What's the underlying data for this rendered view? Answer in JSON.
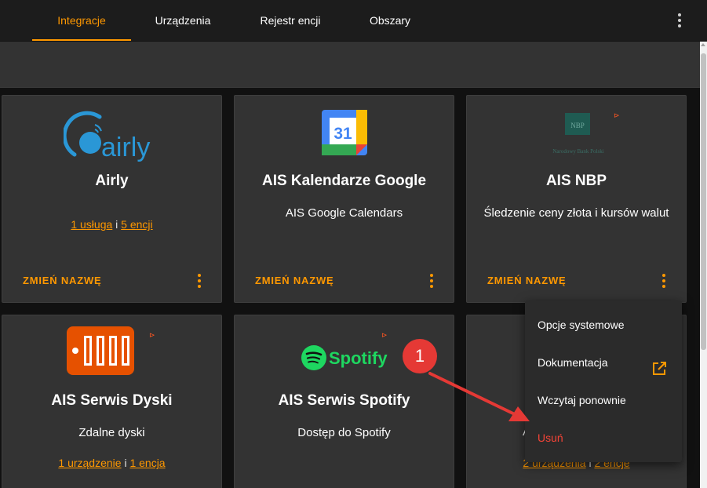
{
  "tabs": [
    {
      "label": "Integracje",
      "active": true
    },
    {
      "label": "Urządzenia",
      "active": false
    },
    {
      "label": "Rejestr encji",
      "active": false
    },
    {
      "label": "Obszary",
      "active": false
    }
  ],
  "cards": [
    {
      "title": "Airly",
      "description": "",
      "links": [
        {
          "text": "1 usługa"
        },
        {
          "sep": " i "
        },
        {
          "text": "5 encji"
        }
      ],
      "rename_label": "ZMIEŃ NAZWĘ",
      "logo": "airly-logo",
      "logo_text": "airly"
    },
    {
      "title": "AIS Kalendarze Google",
      "description": "AIS Google Calendars",
      "rename_label": "ZMIEŃ NAZWĘ",
      "logo": "google-calendar-logo",
      "logo_text": "31"
    },
    {
      "title": "AIS NBP",
      "description": "Śledzenie ceny złota i kursów walut",
      "rename_label": "ZMIEŃ NAZWĘ",
      "logo": "nbp-logo",
      "logo_text": "NBP",
      "logo_subtext": "Narodowy Bank Polski"
    },
    {
      "title": "AIS Serwis Dyski",
      "description": "Zdalne dyski",
      "links": [
        {
          "text": "1 urządzenie"
        },
        {
          "sep": " i "
        },
        {
          "text": "1 encja"
        }
      ],
      "logo": "disks-logo"
    },
    {
      "title": "AIS Serwis Spotify",
      "description": "Dostęp do Spotify",
      "logo": "spotify-logo",
      "logo_text": "Spotify"
    },
    {
      "title": "A",
      "links": [
        {
          "text": "2 urządzenia"
        },
        {
          "sep": " i "
        },
        {
          "text": "2 encje"
        }
      ]
    }
  ],
  "overflow_menu": {
    "items": [
      {
        "label": "Opcje systemowe"
      },
      {
        "label": "Dokumentacja",
        "icon": "open-in-new-icon"
      },
      {
        "label": "Wczytaj ponownie"
      },
      {
        "label": "Usuń",
        "danger": true
      }
    ]
  },
  "annotation": {
    "badge": "1"
  },
  "colors": {
    "accent": "#ff9800",
    "danger": "#f44336",
    "card": "#333333",
    "background": "#111111",
    "badge": "#e53935"
  }
}
